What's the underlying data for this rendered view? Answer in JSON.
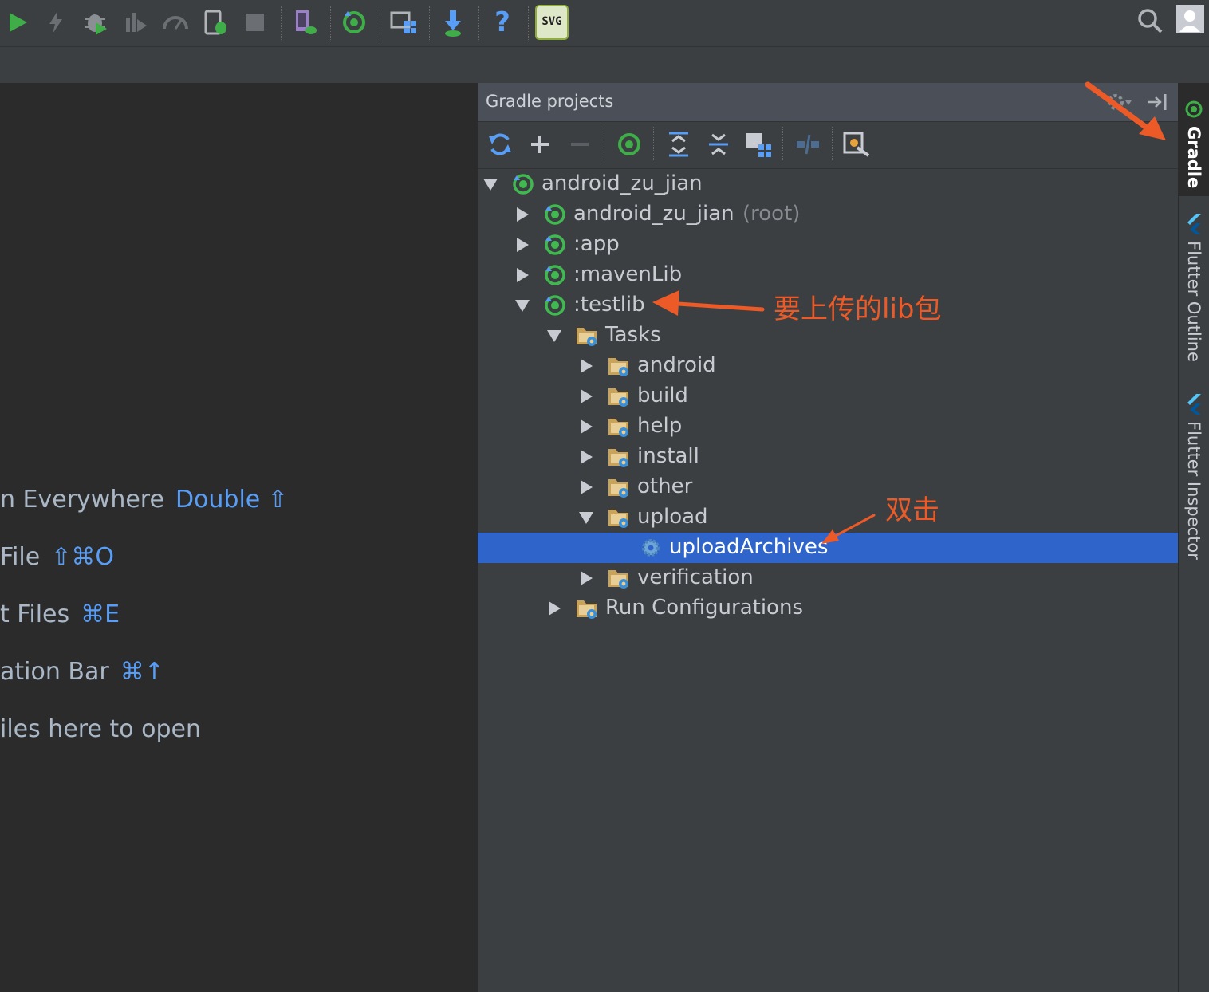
{
  "toolbar": {
    "buttons": [
      "run-icon",
      "apply-changes-icon",
      "debug-icon",
      "profile-icon",
      "attach-debugger-icon",
      "device-debug-icon",
      "stop-icon",
      "avd-manager-icon",
      "gradle-sync-icon",
      "project-structure-icon",
      "sdk-manager-icon",
      "help-icon",
      "svg-plugin-icon"
    ],
    "svg_badge": "SVG",
    "help_glyph": "?"
  },
  "editor_hints": [
    {
      "label": "n Everywhere",
      "key": "Double ⇧"
    },
    {
      "label": "File",
      "key": "⇧⌘O"
    },
    {
      "label": "t Files",
      "key": "⌘E"
    },
    {
      "label": "ation Bar",
      "key": "⌘↑"
    },
    {
      "label": "iles here to open",
      "key": ""
    }
  ],
  "panel": {
    "title": "Gradle projects",
    "tools": [
      "refresh-icon",
      "add-icon",
      "remove-icon",
      "execute-task-icon",
      "expand-all-icon",
      "collapse-all-icon",
      "group-icon",
      "toggle-offline-icon",
      "settings-icon"
    ]
  },
  "tree": [
    {
      "label": "android_zu_jian",
      "suffix": "",
      "type": "project",
      "level": 0,
      "state": "expanded",
      "selected": false
    },
    {
      "label": "android_zu_jian",
      "suffix": "(root)",
      "type": "project",
      "level": 1,
      "state": "collapsed",
      "selected": false
    },
    {
      "label": ":app",
      "suffix": "",
      "type": "project",
      "level": 1,
      "state": "collapsed",
      "selected": false
    },
    {
      "label": ":mavenLib",
      "suffix": "",
      "type": "project",
      "level": 1,
      "state": "collapsed",
      "selected": false
    },
    {
      "label": ":testlib",
      "suffix": "",
      "type": "project",
      "level": 1,
      "state": "expanded",
      "selected": false
    },
    {
      "label": "Tasks",
      "suffix": "",
      "type": "folder",
      "level": 2,
      "state": "expanded",
      "selected": false
    },
    {
      "label": "android",
      "suffix": "",
      "type": "folder",
      "level": 3,
      "state": "collapsed",
      "selected": false
    },
    {
      "label": "build",
      "suffix": "",
      "type": "folder",
      "level": 3,
      "state": "collapsed",
      "selected": false
    },
    {
      "label": "help",
      "suffix": "",
      "type": "folder",
      "level": 3,
      "state": "collapsed",
      "selected": false
    },
    {
      "label": "install",
      "suffix": "",
      "type": "folder",
      "level": 3,
      "state": "collapsed",
      "selected": false
    },
    {
      "label": "other",
      "suffix": "",
      "type": "folder",
      "level": 3,
      "state": "collapsed",
      "selected": false
    },
    {
      "label": "upload",
      "suffix": "",
      "type": "folder",
      "level": 3,
      "state": "expanded",
      "selected": false
    },
    {
      "label": "uploadArchives",
      "suffix": "",
      "type": "task",
      "level": 4,
      "state": "leaf",
      "selected": true
    },
    {
      "label": "verification",
      "suffix": "",
      "type": "folder",
      "level": 3,
      "state": "collapsed",
      "selected": false
    },
    {
      "label": "Run Configurations",
      "suffix": "",
      "type": "folder",
      "level": 2,
      "state": "collapsed",
      "selected": false
    }
  ],
  "stripe": [
    {
      "label": "Gradle",
      "active": true
    },
    {
      "label": "Flutter Outline",
      "active": false
    },
    {
      "label": "Flutter Inspector",
      "active": false
    }
  ],
  "annotations": {
    "lib_note": "要上传的lib包",
    "double_click": "双击"
  },
  "colors": {
    "accent": "#2f65ca",
    "annotation": "#ec5a27",
    "gradle_green": "#3fb950",
    "key_blue": "#589df6"
  }
}
